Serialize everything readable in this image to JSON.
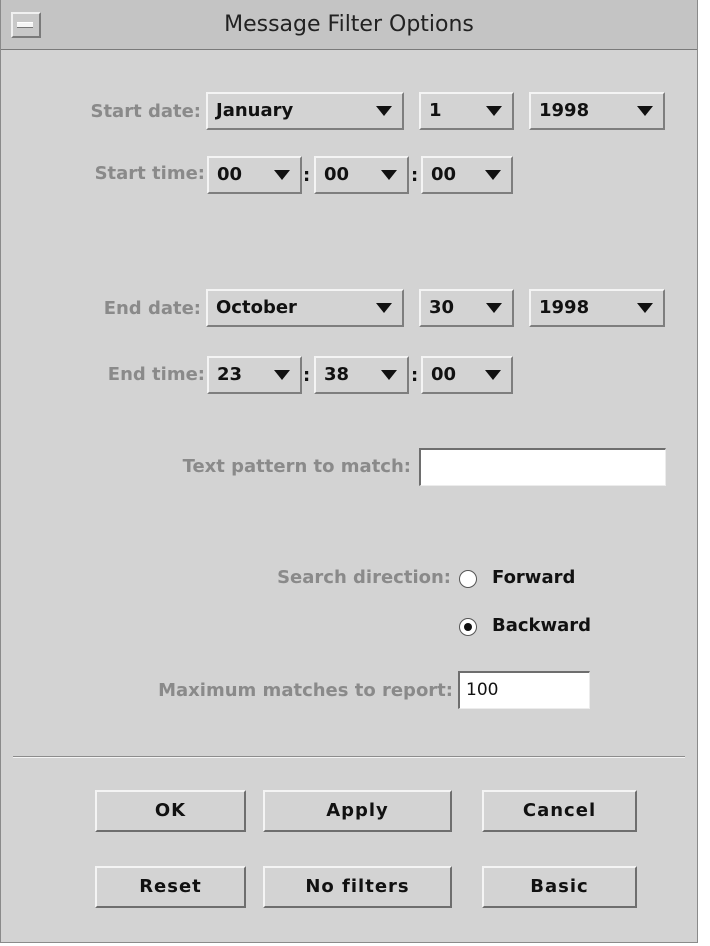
{
  "window": {
    "title": "Message Filter Options"
  },
  "start": {
    "date_label": "Start date:",
    "month": "January",
    "day": "1",
    "year": "1998",
    "time_label": "Start time:",
    "hour": "00",
    "minute": "00",
    "second": "00"
  },
  "end": {
    "date_label": "End date:",
    "month": "October",
    "day": "30",
    "year": "1998",
    "time_label": "End time:",
    "hour": "23",
    "minute": "38",
    "second": "00"
  },
  "time_separator": ":",
  "text_pattern": {
    "label": "Text pattern to match:",
    "value": ""
  },
  "search_direction": {
    "label": "Search direction:",
    "options": [
      {
        "label": "Forward",
        "selected": false
      },
      {
        "label": "Backward",
        "selected": true
      }
    ]
  },
  "max_matches": {
    "label": "Maximum matches to report:",
    "value": "100"
  },
  "buttons": {
    "ok": "OK",
    "apply": "Apply",
    "cancel": "Cancel",
    "reset": "Reset",
    "no_filters": "No filters",
    "basic": "Basic"
  },
  "icons": {
    "combo_arrow": "triangle-down-icon",
    "window_menu": "window-menu-icon"
  }
}
